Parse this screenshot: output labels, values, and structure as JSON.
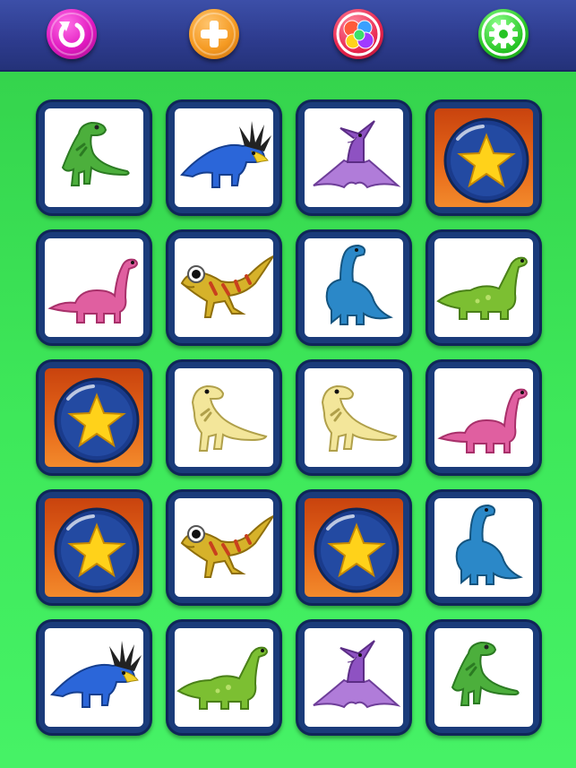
{
  "toolbar": {
    "buttons": [
      {
        "name": "restart-button",
        "icon": "restart-icon",
        "color": "#e119c0"
      },
      {
        "name": "add-button",
        "icon": "plus-icon",
        "color": "#f59a22"
      },
      {
        "name": "bubbles-button",
        "icon": "bubbles-icon",
        "color": "#e8234c"
      },
      {
        "name": "settings-button",
        "icon": "gear-icon",
        "color": "#26c424"
      }
    ]
  },
  "board": {
    "columns": 4,
    "rows": 5,
    "cards": [
      {
        "state": "revealed",
        "image": "green-t-rex"
      },
      {
        "state": "revealed",
        "image": "blue-styracosaurus"
      },
      {
        "state": "revealed",
        "image": "purple-pterodactyl"
      },
      {
        "state": "hidden",
        "image": "star-bubble"
      },
      {
        "state": "revealed",
        "image": "pink-brachiosaurus"
      },
      {
        "state": "revealed",
        "image": "yellow-raptor"
      },
      {
        "state": "revealed",
        "image": "blue-brachiosaurus"
      },
      {
        "state": "revealed",
        "image": "green-brachiosaurus"
      },
      {
        "state": "hidden",
        "image": "star-bubble"
      },
      {
        "state": "revealed",
        "image": "yellow-t-rex"
      },
      {
        "state": "revealed",
        "image": "yellow-t-rex"
      },
      {
        "state": "revealed",
        "image": "pink-brachiosaurus"
      },
      {
        "state": "hidden",
        "image": "star-bubble"
      },
      {
        "state": "revealed",
        "image": "yellow-raptor"
      },
      {
        "state": "hidden",
        "image": "star-bubble"
      },
      {
        "state": "revealed",
        "image": "blue-brachiosaurus"
      },
      {
        "state": "revealed",
        "image": "blue-styracosaurus"
      },
      {
        "state": "revealed",
        "image": "green-brachiosaurus"
      },
      {
        "state": "revealed",
        "image": "purple-pterodactyl"
      },
      {
        "state": "revealed",
        "image": "green-t-rex"
      }
    ]
  },
  "colors": {
    "background": "#3ee85a",
    "toolbar": "#2e3c8f",
    "card_border": "#1a3b7a",
    "card_back": "#e86a1a",
    "star": "#ffd21a"
  }
}
